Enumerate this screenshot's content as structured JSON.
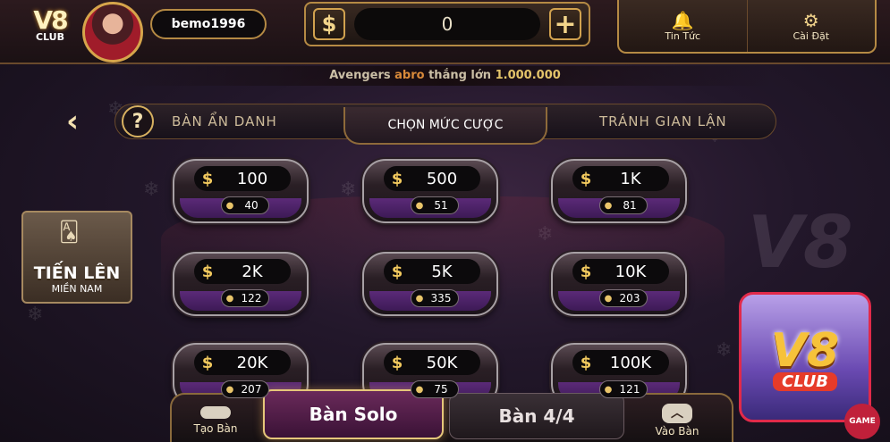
{
  "header": {
    "logo_text": "V8",
    "logo_sub": "CLUB",
    "username": "bemo1996",
    "balance": "0",
    "currency_symbol": "$",
    "plus_symbol": "+",
    "menu": [
      {
        "label": "Tin Tức",
        "icon": "bell-icon",
        "glyph": "🔔"
      },
      {
        "label": "Cài Đặt",
        "icon": "gear-icon",
        "glyph": "⚙"
      }
    ]
  },
  "ticker": {
    "prefix": "Avengers",
    "name": "abro",
    "middle": "thắng lớn",
    "amount": "1.000.000"
  },
  "tabs": {
    "back_glyph": "‹",
    "help_glyph": "?",
    "items": [
      "BÀN ẨN DANH",
      "CHỌN MỨC CƯỢC",
      "TRÁNH GIAN LẬN"
    ]
  },
  "bets": [
    {
      "amount": "100",
      "players": "40"
    },
    {
      "amount": "500",
      "players": "51"
    },
    {
      "amount": "1K",
      "players": "81"
    },
    {
      "amount": "2K",
      "players": "122"
    },
    {
      "amount": "5K",
      "players": "335"
    },
    {
      "amount": "10K",
      "players": "203"
    },
    {
      "amount": "20K",
      "players": "207"
    },
    {
      "amount": "50K",
      "players": "75"
    },
    {
      "amount": "100K",
      "players": "121"
    }
  ],
  "side": {
    "game_title": "TIẾN LÊN",
    "game_sub": "MIỀN NAM",
    "brand_big": "V8",
    "brand_club": "CLUB",
    "game_tag": "GAME"
  },
  "bottom": {
    "create": "Tạo Bàn",
    "solo": "Bàn Solo",
    "four": "Bàn 4/4",
    "join": "Vào Bàn"
  },
  "colors": {
    "gold": "#d1a24f",
    "purple": "#5b2a78",
    "accent_red": "#e12a4a"
  }
}
